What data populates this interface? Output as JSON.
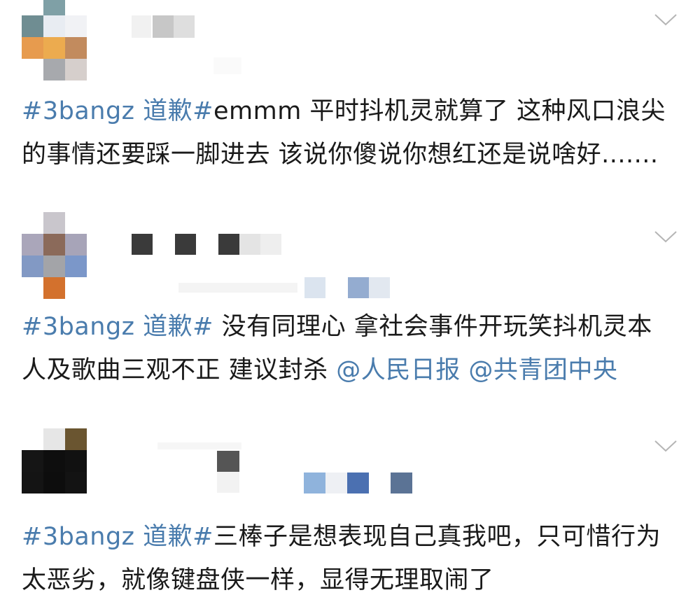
{
  "posts": [
    {
      "hashtag": "#3bangz 道歉#",
      "text": "emmm 平时抖机灵就算了 这种风口浪尖的事情还要踩一脚进去 该说你傻说你想红还是说啥好.......",
      "mentions": []
    },
    {
      "hashtag": "#3bangz 道歉#",
      "text": " 没有同理心 拿社会事件开玩笑抖机灵本人及歌曲三观不正 建议封杀 ",
      "mentions": [
        "@人民日报",
        "@共青团中央"
      ]
    },
    {
      "hashtag": "#3bangz 道歉#",
      "text": "三棒子是想表现自己真我吧，只可惜行为太恶劣，就像键盘侠一样，显得无理取闹了",
      "mentions": []
    }
  ],
  "icons": {
    "chevron": "chevron-down-icon"
  },
  "colors": {
    "link": "#4a7cad",
    "text": "#1a1a1a",
    "chevron": "#b5b5b5"
  }
}
